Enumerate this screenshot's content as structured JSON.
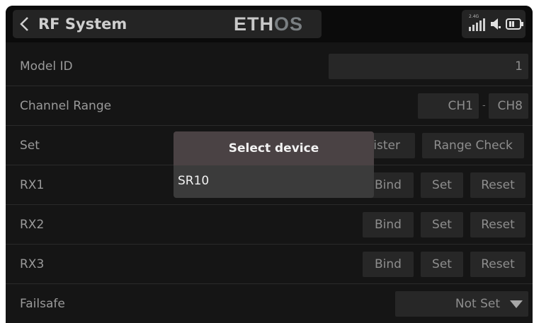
{
  "header": {
    "title": "RF System",
    "logo_main": "ETH",
    "logo_accent": "OS",
    "signal_band": "2.4G",
    "icons": {
      "back": "chevron-left-icon",
      "signal": "signal-strength-icon",
      "speaker": "speaker-icon",
      "battery": "battery-icon"
    }
  },
  "rows": {
    "model_id": {
      "label": "Model ID",
      "value": "1"
    },
    "channel_range": {
      "label": "Channel Range",
      "start": "CH1",
      "separator": "-",
      "end": "CH8"
    },
    "set": {
      "label": "Set",
      "register_label": "Register",
      "range_check_label": "Range Check"
    },
    "rx1": {
      "label": "RX1",
      "bind": "Bind",
      "set": "Set",
      "reset": "Reset"
    },
    "rx2": {
      "label": "RX2",
      "bind": "Bind",
      "set": "Set",
      "reset": "Reset"
    },
    "rx3": {
      "label": "RX3",
      "bind": "Bind",
      "set": "Set",
      "reset": "Reset"
    },
    "failsafe": {
      "label": "Failsafe",
      "value": "Not Set"
    }
  },
  "modal": {
    "title": "Select device",
    "options": [
      "SR10"
    ]
  },
  "colors": {
    "background": "#151515",
    "header": "#0b0b0b",
    "control": "#272727",
    "modal_title": "#4a4244",
    "modal_body": "#3b3b3b"
  }
}
